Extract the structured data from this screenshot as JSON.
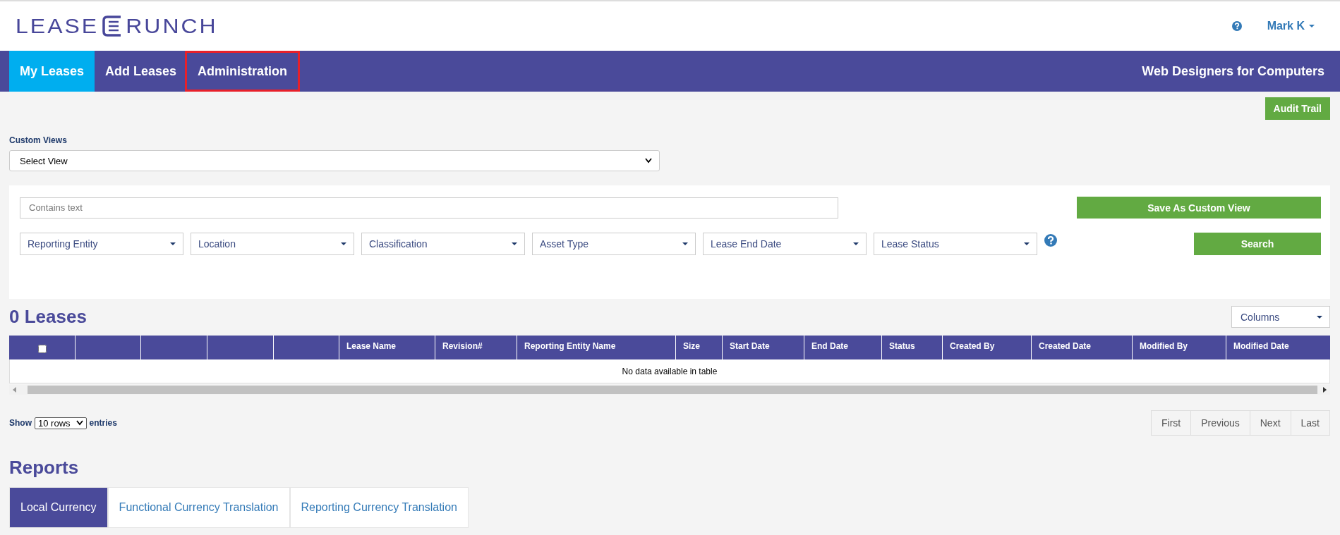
{
  "logo": {
    "left": "LEASE",
    "right": "RUNCH"
  },
  "user_menu": {
    "name": "Mark K"
  },
  "nav": {
    "items": [
      {
        "label": "My Leases",
        "selected": true,
        "highlighted": false
      },
      {
        "label": "Add Leases",
        "selected": false,
        "highlighted": false
      },
      {
        "label": "Administration",
        "selected": false,
        "highlighted": true
      }
    ],
    "company": "Web Designers for Computers"
  },
  "audit_button": "Audit Trail",
  "custom_views": {
    "label": "Custom Views",
    "value": "Select View"
  },
  "filters": {
    "search_placeholder": "Contains text",
    "save_button": "Save As Custom View",
    "dropdowns": [
      "Reporting Entity",
      "Location",
      "Classification",
      "Asset Type",
      "Lease End Date",
      "Lease Status"
    ],
    "search_button": "Search"
  },
  "leases": {
    "title": "0 Leases",
    "columns_button": "Columns",
    "table": {
      "select_all_checked": false,
      "columns": [
        "",
        "",
        "",
        "",
        "",
        "Lease Name",
        "Revision#",
        "Reporting Entity Name",
        "Size",
        "Start Date",
        "End Date",
        "Status",
        "Created By",
        "Created Date",
        "Modified By",
        "Modified Date"
      ],
      "empty_message": "No data available in table"
    },
    "show": {
      "prefix": "Show",
      "value": "10 rows",
      "suffix": "entries"
    },
    "pagination": [
      "First",
      "Previous",
      "Next",
      "Last"
    ]
  },
  "reports": {
    "title": "Reports",
    "tabs": [
      {
        "label": "Local Currency",
        "selected": true
      },
      {
        "label": "Functional Currency Translation",
        "selected": false
      },
      {
        "label": "Reporting Currency Translation",
        "selected": false
      }
    ]
  }
}
